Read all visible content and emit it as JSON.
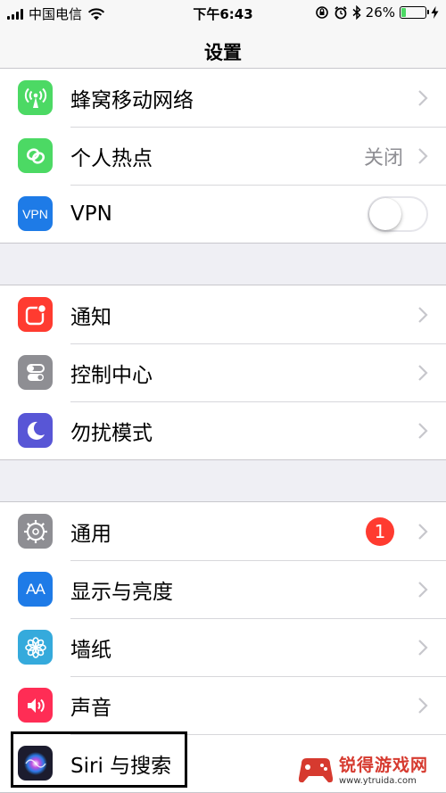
{
  "status_bar": {
    "carrier": "中国电信",
    "time": "下午6:43",
    "battery_percent_text": "26%",
    "battery_level": 0.26
  },
  "nav": {
    "title": "设置"
  },
  "groups": [
    {
      "rows": [
        {
          "label": "蜂窝移动网络",
          "icon": "cellular-antenna-icon",
          "icon_color": "#4cd964"
        },
        {
          "label": "个人热点",
          "icon": "personal-hotspot-icon",
          "icon_color": "#4cd964",
          "value": "关闭"
        },
        {
          "label": "VPN",
          "icon": "vpn-icon",
          "icon_color": "#1e7be7",
          "icon_text": "VPN",
          "toggle": false
        }
      ]
    },
    {
      "rows": [
        {
          "label": "通知",
          "icon": "notifications-icon",
          "icon_color": "#ff3b30"
        },
        {
          "label": "控制中心",
          "icon": "control-center-icon",
          "icon_color": "#8e8e93"
        },
        {
          "label": "勿扰模式",
          "icon": "moon-icon",
          "icon_color": "#5856d6"
        }
      ]
    },
    {
      "rows": [
        {
          "label": "通用",
          "icon": "gear-icon",
          "icon_color": "#8e8e93",
          "badge": "1"
        },
        {
          "label": "显示与亮度",
          "icon": "display-brightness-icon",
          "icon_color": "#1e7be7",
          "icon_text": "AA"
        },
        {
          "label": "墙纸",
          "icon": "wallpaper-flower-icon",
          "icon_color": "#35aadc"
        },
        {
          "label": "声音",
          "icon": "speaker-icon",
          "icon_color": "#ff2d55"
        },
        {
          "label": "Siri 与搜索",
          "icon": "siri-icon",
          "icon_color": "#1c1c2e"
        }
      ]
    }
  ],
  "watermark": {
    "title": "锐得游戏网",
    "url": "www.ytruida.com"
  }
}
